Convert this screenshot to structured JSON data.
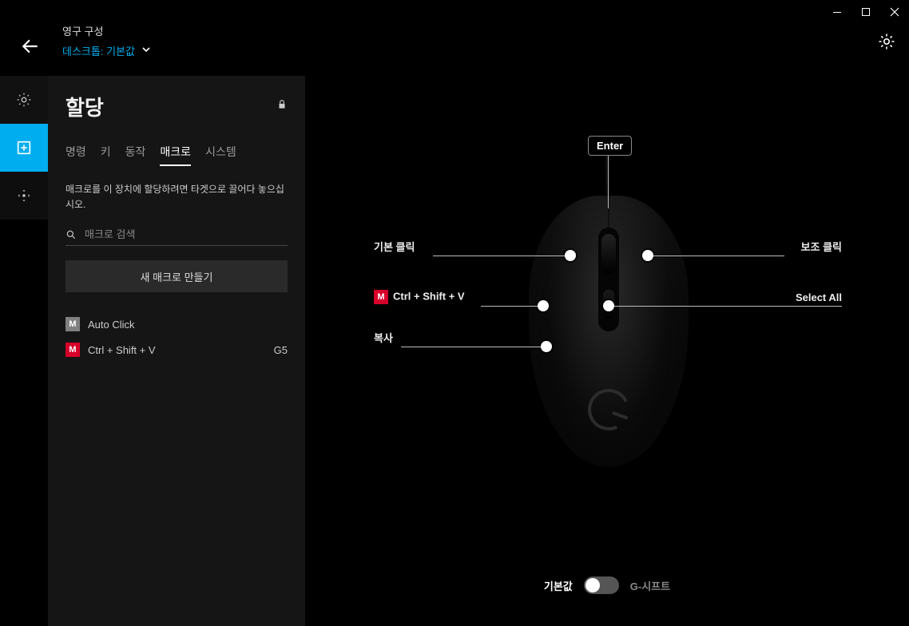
{
  "window_controls": {
    "minimize": "minimize",
    "maximize": "maximize",
    "close": "close"
  },
  "header": {
    "config_title": "영구 구성",
    "profile_label": "데스크톱: 기본값"
  },
  "rail": {
    "lighting": "lighting",
    "assignments": "assignments",
    "sensitivity": "sensitivity"
  },
  "sidebar": {
    "title": "할당",
    "tabs": {
      "commands": "명령",
      "keys": "키",
      "actions": "동작",
      "macros": "매크로",
      "system": "시스템"
    },
    "hint": "매크로를 이 장치에 할당하려면 타겟으로 끌어다 놓으십시오.",
    "search_placeholder": "매크로 검색",
    "new_macro": "새 매크로 만들기",
    "badge": "M",
    "macros": [
      {
        "name": "Auto Click",
        "slot": ""
      },
      {
        "name": "Ctrl + Shift + V",
        "slot": "G5"
      }
    ]
  },
  "mouse": {
    "enter": "Enter",
    "left_click": "기본 클릭",
    "right_click": "보조 클릭",
    "g5": "Ctrl + Shift + V",
    "g4": "복사",
    "select_all": "Select All"
  },
  "gshift": {
    "default": "기본값",
    "gshift": "G-시프트"
  }
}
